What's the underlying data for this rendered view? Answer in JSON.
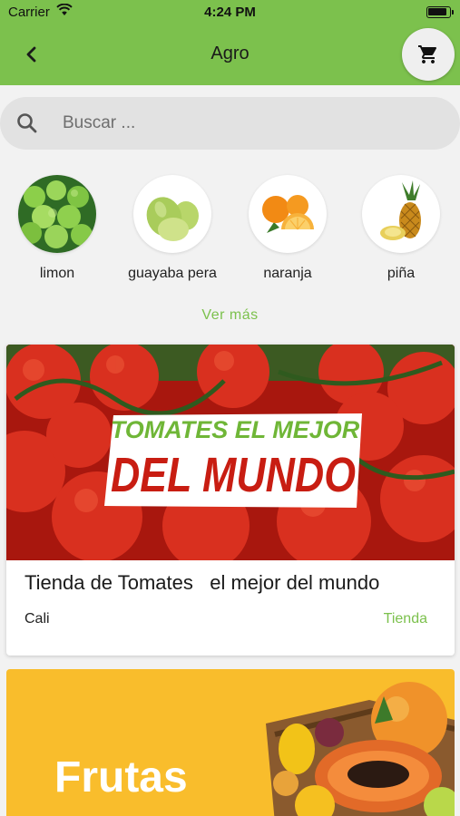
{
  "status_bar": {
    "carrier": "Carrier",
    "time": "4:24 PM"
  },
  "nav": {
    "title": "Agro"
  },
  "search": {
    "placeholder": "Buscar ..."
  },
  "categories": [
    {
      "label": "limon"
    },
    {
      "label": "guayaba pera"
    },
    {
      "label": "naranja"
    },
    {
      "label": "piña"
    }
  ],
  "see_more": "Ver más",
  "store_card": {
    "banner_line1": "TOMATES EL MEJOR",
    "banner_line2": "DEL MUNDO",
    "name": "Tienda de Tomates   el mejor del mundo",
    "city": "Cali",
    "link": "Tienda"
  },
  "promo": {
    "word": "Frutas"
  },
  "colors": {
    "primary": "#7cc14d",
    "promo_bg": "#f9bd2c",
    "tomato": "#d9301f"
  }
}
